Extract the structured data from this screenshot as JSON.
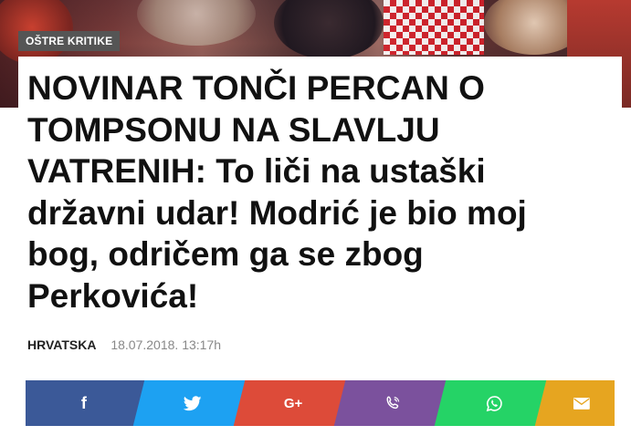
{
  "article": {
    "category": "OŠTRE KRITIKE",
    "headline": "NOVINAR TONČI PERCAN O TOMPSONU NA SLAVLJU VATRENIH: To liči na ustaški državni udar! Modrić je bio moj bog, odričem ga se zbog Perkovića!",
    "section": "HRVATSKA",
    "date": "18.07.2018. 13:17h"
  },
  "share": {
    "buttons": [
      {
        "name": "facebook",
        "icon": "facebook-icon",
        "glyph": "f",
        "color": "#3b5998"
      },
      {
        "name": "twitter",
        "icon": "twitter-icon",
        "glyph": "",
        "color": "#1da1f2"
      },
      {
        "name": "google-plus",
        "icon": "google-plus-icon",
        "glyph": "G+",
        "color": "#dd4b39"
      },
      {
        "name": "viber",
        "icon": "viber-icon",
        "glyph": "",
        "color": "#7b519d"
      },
      {
        "name": "whatsapp",
        "icon": "whatsapp-icon",
        "glyph": "",
        "color": "#25d366"
      },
      {
        "name": "email",
        "icon": "email-icon",
        "glyph": "",
        "color": "#e6a520"
      }
    ]
  },
  "colors": {
    "badge_bg": "#555555",
    "headline_text": "#111111",
    "date_text": "#888888"
  }
}
